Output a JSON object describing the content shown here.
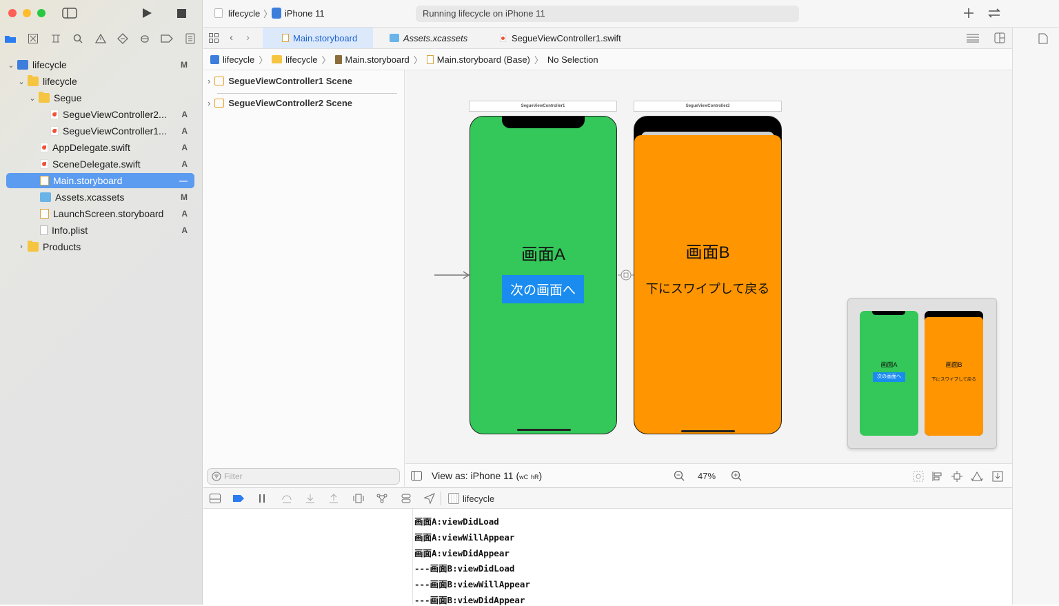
{
  "sidebar": {
    "tree": [
      {
        "label": "lifecycle",
        "badge": "M"
      },
      {
        "label": "lifecycle",
        "badge": ""
      },
      {
        "label": "Segue",
        "badge": ""
      },
      {
        "label": "SegueViewController2...",
        "badge": "A"
      },
      {
        "label": "SegueViewController1...",
        "badge": "A"
      },
      {
        "label": "AppDelegate.swift",
        "badge": "A"
      },
      {
        "label": "SceneDelegate.swift",
        "badge": "A"
      },
      {
        "label": "Main.storyboard",
        "badge": "—"
      },
      {
        "label": "Assets.xcassets",
        "badge": "M"
      },
      {
        "label": "LaunchScreen.storyboard",
        "badge": "A"
      },
      {
        "label": "Info.plist",
        "badge": "A"
      },
      {
        "label": "Products",
        "badge": ""
      }
    ]
  },
  "toolbar": {
    "scheme": "lifecycle",
    "device": "iPhone 11",
    "status": "Running lifecycle on iPhone 11"
  },
  "tabs": [
    "Main.storyboard",
    "Assets.xcassets",
    "SegueViewController1.swift"
  ],
  "breadcrumb": [
    "lifecycle",
    "lifecycle",
    "Main.storyboard",
    "Main.storyboard (Base)",
    "No Selection"
  ],
  "outline": {
    "scenes": [
      "SegueViewController1 Scene",
      "SegueViewController2 Scene"
    ],
    "filter_placeholder": "Filter"
  },
  "canvas": {
    "vc1_label": "SegueViewController1",
    "vc2_label": "SegueViewController2",
    "screen_a_title": "画面A",
    "screen_a_button": "次の画面へ",
    "screen_b_title": "画面B",
    "screen_b_text": "下にスワイプして戻る",
    "green": "#34c759",
    "orange": "#ff9500",
    "button_blue": "#1a8cf0",
    "minimap": {
      "a_title": "画面A",
      "a_button": "次の画面へ",
      "b_title": "画面B",
      "b_text": "下にスワイプして戻る"
    }
  },
  "canvas_bar": {
    "view_as_prefix": "View as: iPhone 11 (",
    "w_class": "wC",
    "h_class": "hR",
    "view_as_suffix": ")",
    "zoom": "47%"
  },
  "debug": {
    "target": "lifecycle",
    "logs": [
      "画面A:viewDidLoad",
      "画面A:viewWillAppear",
      "画面A:viewDidAppear",
      "---画面B:viewDidLoad",
      "---画面B:viewWillAppear",
      "---画面B:viewDidAppear"
    ]
  }
}
